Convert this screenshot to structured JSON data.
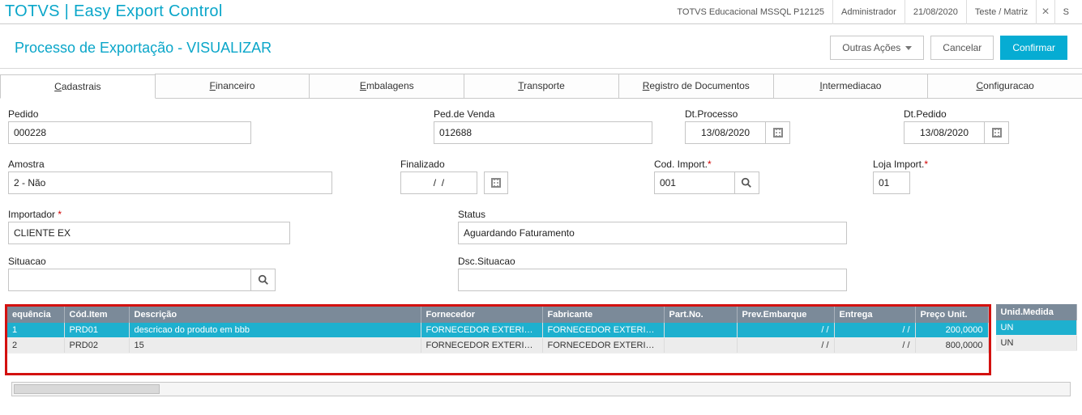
{
  "appbar": {
    "title": "TOTVS | Easy Export Control",
    "env": "TOTVS Educacional MSSQL P12125",
    "user": "Administrador",
    "date": "21/08/2020",
    "branch": "Teste / Matriz",
    "extra": "S"
  },
  "toolbar": {
    "title": "Processo de Exportação - VISUALIZAR",
    "other_actions": "Outras Ações",
    "cancel": "Cancelar",
    "confirm": "Confirmar"
  },
  "tabs": {
    "cadastrais": {
      "u": "C",
      "rest": "adastrais"
    },
    "financeiro": {
      "u": "F",
      "rest": "inanceiro"
    },
    "embalagens": {
      "u": "E",
      "rest": "mbalagens"
    },
    "transporte": {
      "u": "T",
      "rest": "ransporte"
    },
    "registro": {
      "u": "R",
      "rest": "egistro de Documentos"
    },
    "intermediacao": {
      "u": "I",
      "rest": "ntermediacao"
    },
    "configuracao": {
      "u": "C",
      "rest": "onfiguracao"
    }
  },
  "form": {
    "pedido_label": "Pedido",
    "pedido": "000228",
    "ped_venda_label": "Ped.de Venda",
    "ped_venda": "012688",
    "dt_processo_label": "Dt.Processo",
    "dt_processo": "13/08/2020",
    "dt_pedido_label": "Dt.Pedido",
    "dt_pedido": "13/08/2020",
    "amostra_label": "Amostra",
    "amostra": "2 - Não",
    "finalizado_label": "Finalizado",
    "finalizado": "/  /",
    "cod_import_label": "Cod. Import.",
    "cod_import": "001",
    "loja_import_label": "Loja Import.",
    "loja_import": "01",
    "importador_label": "Importador",
    "importador": "CLIENTE EX",
    "status_label": "Status",
    "status": "Aguardando Faturamento",
    "situacao_label": "Situacao",
    "situacao": "",
    "dsc_situacao_label": "Dsc.Situacao",
    "dsc_situacao": ""
  },
  "grid": {
    "headers": {
      "seq": "equência",
      "cod": "Cód.Item",
      "desc": "Descrição",
      "forn": "Fornecedor",
      "fab": "Fabricante",
      "part": "Part.No.",
      "prev": "Prev.Embarque",
      "entr": "Entrega",
      "preco": "Preço Unit.",
      "unid": "Unid.Medida"
    },
    "rows": [
      {
        "seq": "1",
        "cod": "PRD01",
        "desc": "descricao do produto em bbb",
        "forn": "FORNECEDOR EXTERIOR",
        "fab": "FORNECEDOR EXTERIOR",
        "part": "",
        "prev": "/  /",
        "entr": "/  /",
        "preco": "200,0000",
        "unid": "UN"
      },
      {
        "seq": "2",
        "cod": "PRD02",
        "desc": "15",
        "forn": "FORNECEDOR EXTERIOR",
        "fab": "FORNECEDOR EXTERIOR",
        "part": "",
        "prev": "/  /",
        "entr": "/  /",
        "preco": "800,0000",
        "unid": "UN"
      }
    ]
  }
}
